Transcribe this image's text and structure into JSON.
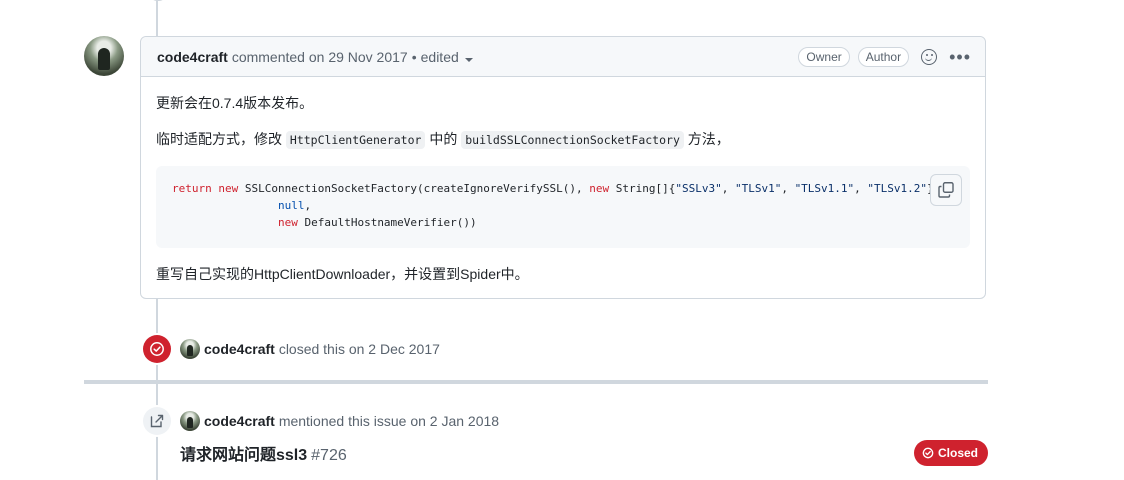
{
  "comment": {
    "author": "code4craft",
    "action": "commented on",
    "date": "29 Nov 2017",
    "bullet": "•",
    "edited": "edited",
    "labels": {
      "owner": "Owner",
      "author": "Author"
    },
    "more": "•••",
    "para1": "更新会在0.7.4版本发布。",
    "para2_prefix": "临时适配方式，修改",
    "code_inline_1": "HttpClientGenerator",
    "para2_mid": "中的",
    "code_inline_2": "buildSSLConnectionSocketFactory",
    "para2_suffix": "方法，",
    "code_block": {
      "line1_kw": "return new",
      "line1_a": " SSLConnectionSocketFactory(createIgnoreVerifySSL(), ",
      "line1_kw2": "new",
      "line1_b": " String[]{",
      "s1": "\"SSLv3\"",
      "s2": "\"TLSv1\"",
      "s3": "\"TLSv1.1\"",
      "s4": "\"TLSv1.2\"",
      "line1_end": "},",
      "line2": "null",
      "line3_kw": "new",
      "line3_rest": " DefaultHostnameVerifier())"
    },
    "para3": "重写自己实现的HttpClientDownloader，并设置到Spider中。"
  },
  "close_event": {
    "actor": "code4craft",
    "text": "closed this on 2 Dec 2017"
  },
  "mention_event": {
    "actor": "code4craft",
    "text": "mentioned this issue on 2 Jan 2018",
    "issue_title": "请求网站问题ssl3",
    "issue_number": "#726",
    "state": "Closed"
  },
  "colors": {
    "closed_red": "#cf222e",
    "border": "#d0d7de",
    "muted": "#59636e"
  },
  "icons": [
    "copy-icon",
    "smiley-icon",
    "kebab-icon",
    "issue-closed-icon",
    "cross-reference-icon",
    "caret-down-icon"
  ]
}
